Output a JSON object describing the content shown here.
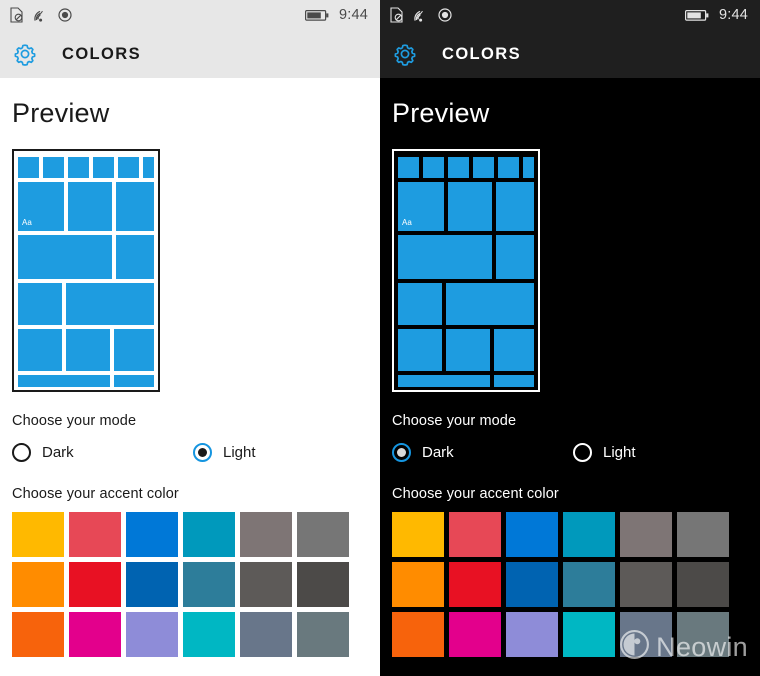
{
  "accent_color": "#1e9ce0",
  "selection_ring_color": "#1595e0",
  "statusbar": {
    "icons": [
      "no-sim-icon",
      "wifi-icon",
      "record-circle-icon"
    ],
    "battery_icon": "battery-icon",
    "clock": "9:44"
  },
  "appbar": {
    "icon": "gear-icon",
    "title": "COLORS"
  },
  "preview": {
    "heading": "Preview",
    "tile_sample_text": "Aa"
  },
  "mode": {
    "label": "Choose your mode",
    "options": [
      {
        "label": "Dark",
        "value": "dark"
      },
      {
        "label": "Light",
        "value": "light"
      }
    ]
  },
  "accent": {
    "label": "Choose your accent color",
    "swatches": [
      "#FFB900",
      "#E74856",
      "#0078D7",
      "#0099BC",
      "#7E7575",
      "#767676",
      "#FF8C00",
      "#E81123",
      "#0063B1",
      "#2D7D9A",
      "#5D5A58",
      "#4C4A48",
      "#F7630C",
      "#E3008C",
      "#8E8CD8",
      "#00B7C3",
      "#68768A",
      "#69797E"
    ]
  },
  "panels": {
    "left": {
      "theme": "light",
      "selected_mode": "light"
    },
    "right": {
      "theme": "dark",
      "selected_mode": "dark"
    }
  },
  "watermark": {
    "text": "Neowin",
    "icon": "neowin-logo-icon"
  }
}
